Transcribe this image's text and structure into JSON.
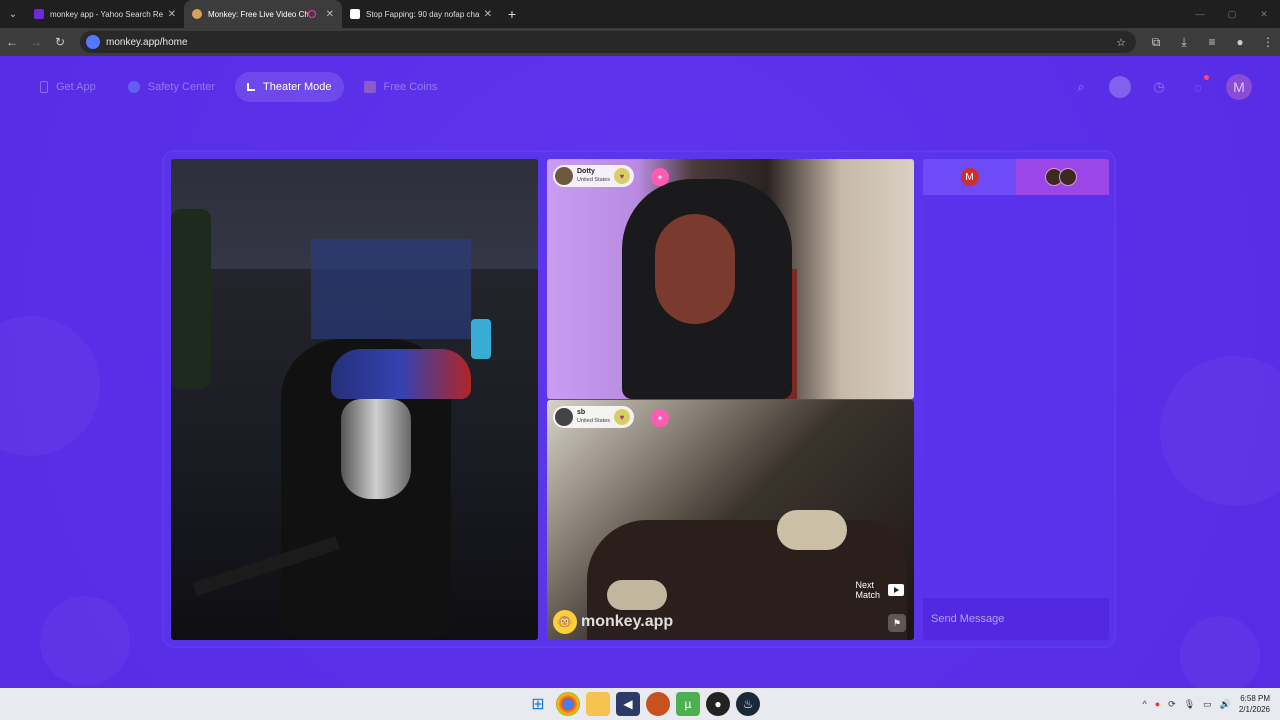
{
  "browser": {
    "tabs": [
      {
        "title": "monkey app - Yahoo Search Re",
        "active": false,
        "fav_color": "#6c2bd9"
      },
      {
        "title": "Monkey: Free Live Video Ch",
        "active": true,
        "fav_color": "#d9a25a"
      },
      {
        "title": "Stop Fapping: 90 day nofap cha",
        "active": false,
        "fav_color": "#ffffff"
      }
    ],
    "url": "monkey.app/home"
  },
  "nav": {
    "get_app": "Get App",
    "safety_center": "Safety Center",
    "theater_mode": "Theater Mode",
    "free_coins": "Free Coins",
    "user_initial": "M"
  },
  "videos": {
    "top_right": {
      "username": "Dotty",
      "country": "United States"
    },
    "bottom_right": {
      "username": "sb",
      "country": "United States"
    },
    "next_match_line1": "Next",
    "next_match_line2": "Match",
    "brand": "monkey.app"
  },
  "chat": {
    "tab1_initial": "M",
    "placeholder": "Send Message"
  },
  "taskbar": {
    "time": "6:58 PM",
    "date": "2/1/2026"
  },
  "colors": {
    "accent": "#5a2fe8",
    "pink": "#ff5bb3"
  }
}
